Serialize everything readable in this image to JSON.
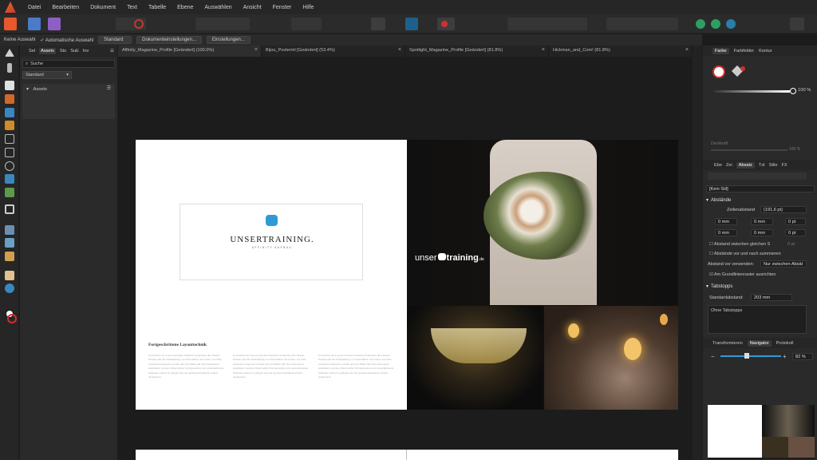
{
  "menu": [
    "Datei",
    "Bearbeiten",
    "Dokument",
    "Text",
    "Tabelle",
    "Ebene",
    "Auswählen",
    "Ansicht",
    "Fenster",
    "Hilfe"
  ],
  "context": {
    "selection": "Keine Auswahl",
    "auto_select": "Automatische Auswahl",
    "mode": "Standard",
    "doc_settings": "Dokumenteinstellungen...",
    "settings": "Einstellungen..."
  },
  "left_panel": {
    "tabs": [
      "Sel",
      "Assets",
      "Sto",
      "SuE",
      "Inv"
    ],
    "search_placeholder": "Suche",
    "category": "Standard",
    "section": "Assets"
  },
  "doc_tabs": [
    "Affinity_Magazine_Profile [Geändert] (100.0%)",
    "Bijou_Posterml [Geändert] (53.4%)",
    "Spotlight_Magazine_Profile [Geändert] (81.8%)",
    "Hickman_and_Com! (81.8%)"
  ],
  "page": {
    "logo_title": "UNSERTRAINING.",
    "logo_sub": "AFFINITY AUFBAU",
    "heading": "Fortgeschrittene Layouttechnik",
    "photo_caption": "unser",
    "photo_caption_bold": "training",
    "photo_caption_suffix": ".de",
    "body_text": "Fortschritte im Layout erfordern fundierte Kenntnisse über Raster, Ebenen und die Verknüpfung von Textrahmen. Sie lernen, wie Stile konsistent eingesetzt werden und wie Bilder mit Text harmonisch kombiniert werden. Dabei helfen Vorlagenseiten, um wiederkehrende Elemente zentral zu pflegen und das gesamte Dokument schnell anzupassen."
  },
  "right_panel": {
    "tabs_top": [
      "Farbe",
      "Farbfelder",
      "Kontur"
    ],
    "opacity": "100 %",
    "opacity2": "100 %",
    "opacity_label": "Deckkraft",
    "tabs_mid": [
      "Ebe",
      "Zei",
      "Absatz",
      "Txt",
      "Stile",
      "FX"
    ],
    "style_select": "[Kein Stil]",
    "section_spacing": "Abstände",
    "line_spacing_label": "Zeilenabstand",
    "line_spacing": "(191,6 pt)",
    "indent_values": [
      "0 mm",
      "0 mm",
      "0 pt",
      "0 mm",
      "0 mm",
      "0 pt"
    ],
    "check1": "Abstand zwischen gleichen S",
    "check1_val": "0 pt",
    "check2": "Abstände vor und nach summieren",
    "spacing_before_label": "Abstand vor verwenden:",
    "spacing_before_val": "Nur zwischen Absät",
    "check3": "Am Grundlinienraster ausrichten",
    "section_tabs": "Tabstopps",
    "default_distance_label": "Standardabstand:",
    "default_distance": "203 mm",
    "tabs_list": "Ohne Tabstopps",
    "tabs_bottom": [
      "Transformieren",
      "Navigator",
      "Protokoll"
    ],
    "zoom": "82 %"
  },
  "colors": {
    "accent_blue": "#2f9bd6",
    "selected_tab": "#3a3a3a",
    "red": "#d0302f"
  }
}
